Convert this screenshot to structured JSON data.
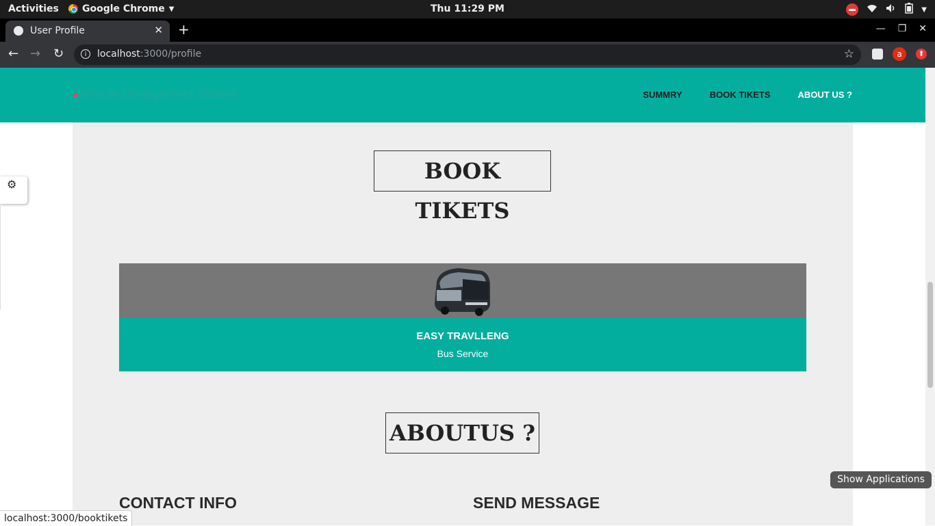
{
  "system_bar": {
    "activities": "Activities",
    "app_name": "Google Chrome",
    "clock": "Thu 11:29 PM"
  },
  "browser": {
    "tab_title": "User Profile",
    "url_host": "localhost",
    "url_path": ":3000/profile",
    "profile_initial": "a"
  },
  "site": {
    "brand": "Vehicle Management System",
    "nav": [
      {
        "label": "SUMMRY"
      },
      {
        "label": "BOOK TIKETS"
      },
      {
        "label": "ABOUT US ?"
      }
    ]
  },
  "book_section": {
    "title": "BOOK TIKETS",
    "card": {
      "name": "EASY TRAVLLENG",
      "subtitle": "Bus Service"
    }
  },
  "about_section": {
    "title": "ABOUTUS ?",
    "contact_heading": "CONTACT INFO",
    "message_heading": "SEND MESSAGE"
  },
  "status_bar_url": "localhost:3000/booktikets",
  "show_applications": "Show Applications",
  "colors": {
    "accent_teal": "#03ae9e",
    "card_media_gray": "#777777",
    "content_bg": "#eeeeee"
  }
}
